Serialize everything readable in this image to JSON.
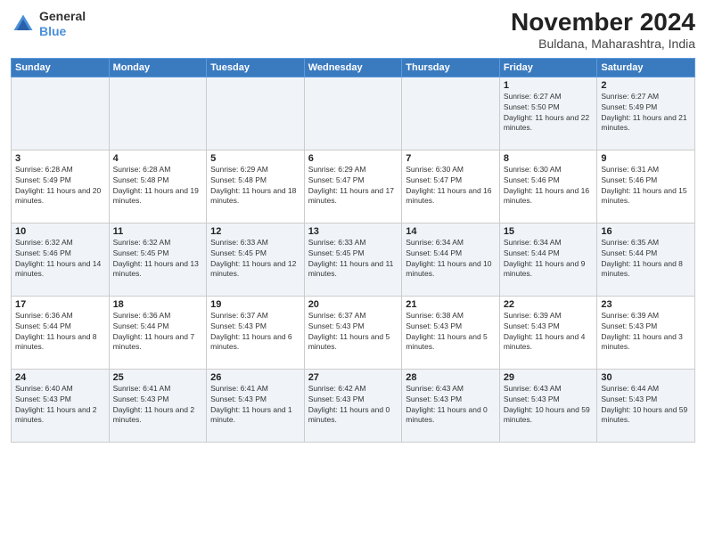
{
  "header": {
    "logo_general": "General",
    "logo_blue": "Blue",
    "month_title": "November 2024",
    "location": "Buldana, Maharashtra, India"
  },
  "days_of_week": [
    "Sunday",
    "Monday",
    "Tuesday",
    "Wednesday",
    "Thursday",
    "Friday",
    "Saturday"
  ],
  "weeks": [
    [
      {
        "day": "",
        "info": ""
      },
      {
        "day": "",
        "info": ""
      },
      {
        "day": "",
        "info": ""
      },
      {
        "day": "",
        "info": ""
      },
      {
        "day": "",
        "info": ""
      },
      {
        "day": "1",
        "info": "Sunrise: 6:27 AM\nSunset: 5:50 PM\nDaylight: 11 hours and 22 minutes."
      },
      {
        "day": "2",
        "info": "Sunrise: 6:27 AM\nSunset: 5:49 PM\nDaylight: 11 hours and 21 minutes."
      }
    ],
    [
      {
        "day": "3",
        "info": "Sunrise: 6:28 AM\nSunset: 5:49 PM\nDaylight: 11 hours and 20 minutes."
      },
      {
        "day": "4",
        "info": "Sunrise: 6:28 AM\nSunset: 5:48 PM\nDaylight: 11 hours and 19 minutes."
      },
      {
        "day": "5",
        "info": "Sunrise: 6:29 AM\nSunset: 5:48 PM\nDaylight: 11 hours and 18 minutes."
      },
      {
        "day": "6",
        "info": "Sunrise: 6:29 AM\nSunset: 5:47 PM\nDaylight: 11 hours and 17 minutes."
      },
      {
        "day": "7",
        "info": "Sunrise: 6:30 AM\nSunset: 5:47 PM\nDaylight: 11 hours and 16 minutes."
      },
      {
        "day": "8",
        "info": "Sunrise: 6:30 AM\nSunset: 5:46 PM\nDaylight: 11 hours and 16 minutes."
      },
      {
        "day": "9",
        "info": "Sunrise: 6:31 AM\nSunset: 5:46 PM\nDaylight: 11 hours and 15 minutes."
      }
    ],
    [
      {
        "day": "10",
        "info": "Sunrise: 6:32 AM\nSunset: 5:46 PM\nDaylight: 11 hours and 14 minutes."
      },
      {
        "day": "11",
        "info": "Sunrise: 6:32 AM\nSunset: 5:45 PM\nDaylight: 11 hours and 13 minutes."
      },
      {
        "day": "12",
        "info": "Sunrise: 6:33 AM\nSunset: 5:45 PM\nDaylight: 11 hours and 12 minutes."
      },
      {
        "day": "13",
        "info": "Sunrise: 6:33 AM\nSunset: 5:45 PM\nDaylight: 11 hours and 11 minutes."
      },
      {
        "day": "14",
        "info": "Sunrise: 6:34 AM\nSunset: 5:44 PM\nDaylight: 11 hours and 10 minutes."
      },
      {
        "day": "15",
        "info": "Sunrise: 6:34 AM\nSunset: 5:44 PM\nDaylight: 11 hours and 9 minutes."
      },
      {
        "day": "16",
        "info": "Sunrise: 6:35 AM\nSunset: 5:44 PM\nDaylight: 11 hours and 8 minutes."
      }
    ],
    [
      {
        "day": "17",
        "info": "Sunrise: 6:36 AM\nSunset: 5:44 PM\nDaylight: 11 hours and 8 minutes."
      },
      {
        "day": "18",
        "info": "Sunrise: 6:36 AM\nSunset: 5:44 PM\nDaylight: 11 hours and 7 minutes."
      },
      {
        "day": "19",
        "info": "Sunrise: 6:37 AM\nSunset: 5:43 PM\nDaylight: 11 hours and 6 minutes."
      },
      {
        "day": "20",
        "info": "Sunrise: 6:37 AM\nSunset: 5:43 PM\nDaylight: 11 hours and 5 minutes."
      },
      {
        "day": "21",
        "info": "Sunrise: 6:38 AM\nSunset: 5:43 PM\nDaylight: 11 hours and 5 minutes."
      },
      {
        "day": "22",
        "info": "Sunrise: 6:39 AM\nSunset: 5:43 PM\nDaylight: 11 hours and 4 minutes."
      },
      {
        "day": "23",
        "info": "Sunrise: 6:39 AM\nSunset: 5:43 PM\nDaylight: 11 hours and 3 minutes."
      }
    ],
    [
      {
        "day": "24",
        "info": "Sunrise: 6:40 AM\nSunset: 5:43 PM\nDaylight: 11 hours and 2 minutes."
      },
      {
        "day": "25",
        "info": "Sunrise: 6:41 AM\nSunset: 5:43 PM\nDaylight: 11 hours and 2 minutes."
      },
      {
        "day": "26",
        "info": "Sunrise: 6:41 AM\nSunset: 5:43 PM\nDaylight: 11 hours and 1 minute."
      },
      {
        "day": "27",
        "info": "Sunrise: 6:42 AM\nSunset: 5:43 PM\nDaylight: 11 hours and 0 minutes."
      },
      {
        "day": "28",
        "info": "Sunrise: 6:43 AM\nSunset: 5:43 PM\nDaylight: 11 hours and 0 minutes."
      },
      {
        "day": "29",
        "info": "Sunrise: 6:43 AM\nSunset: 5:43 PM\nDaylight: 10 hours and 59 minutes."
      },
      {
        "day": "30",
        "info": "Sunrise: 6:44 AM\nSunset: 5:43 PM\nDaylight: 10 hours and 59 minutes."
      }
    ]
  ]
}
